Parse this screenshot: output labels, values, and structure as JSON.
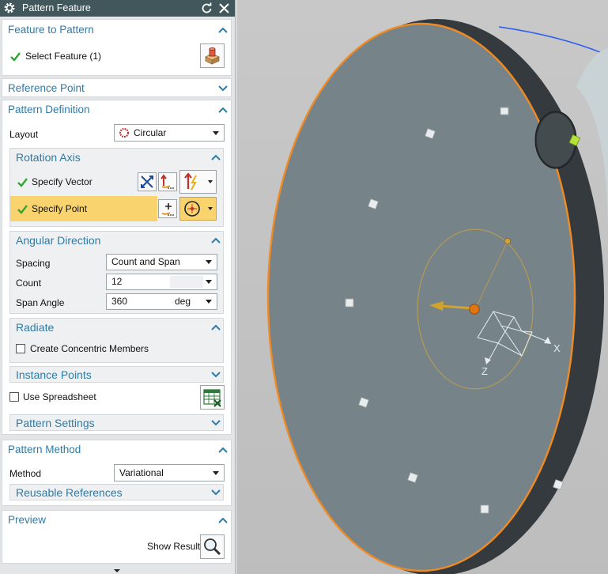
{
  "dialog": {
    "title": "Pattern Feature",
    "feature_to_pattern": {
      "title": "Feature to Pattern",
      "select_feature": "Select Feature (1)"
    },
    "reference_point": {
      "title": "Reference Point"
    },
    "pattern_definition": {
      "title": "Pattern Definition",
      "layout_label": "Layout",
      "layout_value": "Circular",
      "rotation_axis": {
        "title": "Rotation Axis",
        "specify_vector": "Specify Vector",
        "specify_point": "Specify Point"
      },
      "angular_direction": {
        "title": "Angular Direction",
        "spacing_label": "Spacing",
        "spacing_value": "Count and Span",
        "count_label": "Count",
        "count_value": "12",
        "span_label": "Span Angle",
        "span_value": "360",
        "span_unit": "deg"
      },
      "radiate": {
        "title": "Radiate",
        "concentric_label": "Create Concentric Members",
        "concentric_checked": false
      },
      "instance_points": {
        "title": "Instance Points"
      },
      "use_spreadsheet": {
        "label": "Use Spreadsheet",
        "checked": false
      },
      "pattern_settings": {
        "title": "Pattern Settings"
      }
    },
    "pattern_method": {
      "title": "Pattern Method",
      "method_label": "Method",
      "method_value": "Variational",
      "reusable_references": {
        "title": "Reusable References"
      }
    },
    "preview": {
      "title": "Preview",
      "show_result": "Show Result"
    }
  },
  "viewport": {
    "axis_x": "X",
    "axis_z": "Z"
  },
  "colors": {
    "titlebar": "#42575b",
    "accent": "#2e7ba7",
    "highlight": "#f9d36e",
    "check": "#2fa62f",
    "disc_face": "#76848a",
    "disc_edge": "#f08a24"
  }
}
